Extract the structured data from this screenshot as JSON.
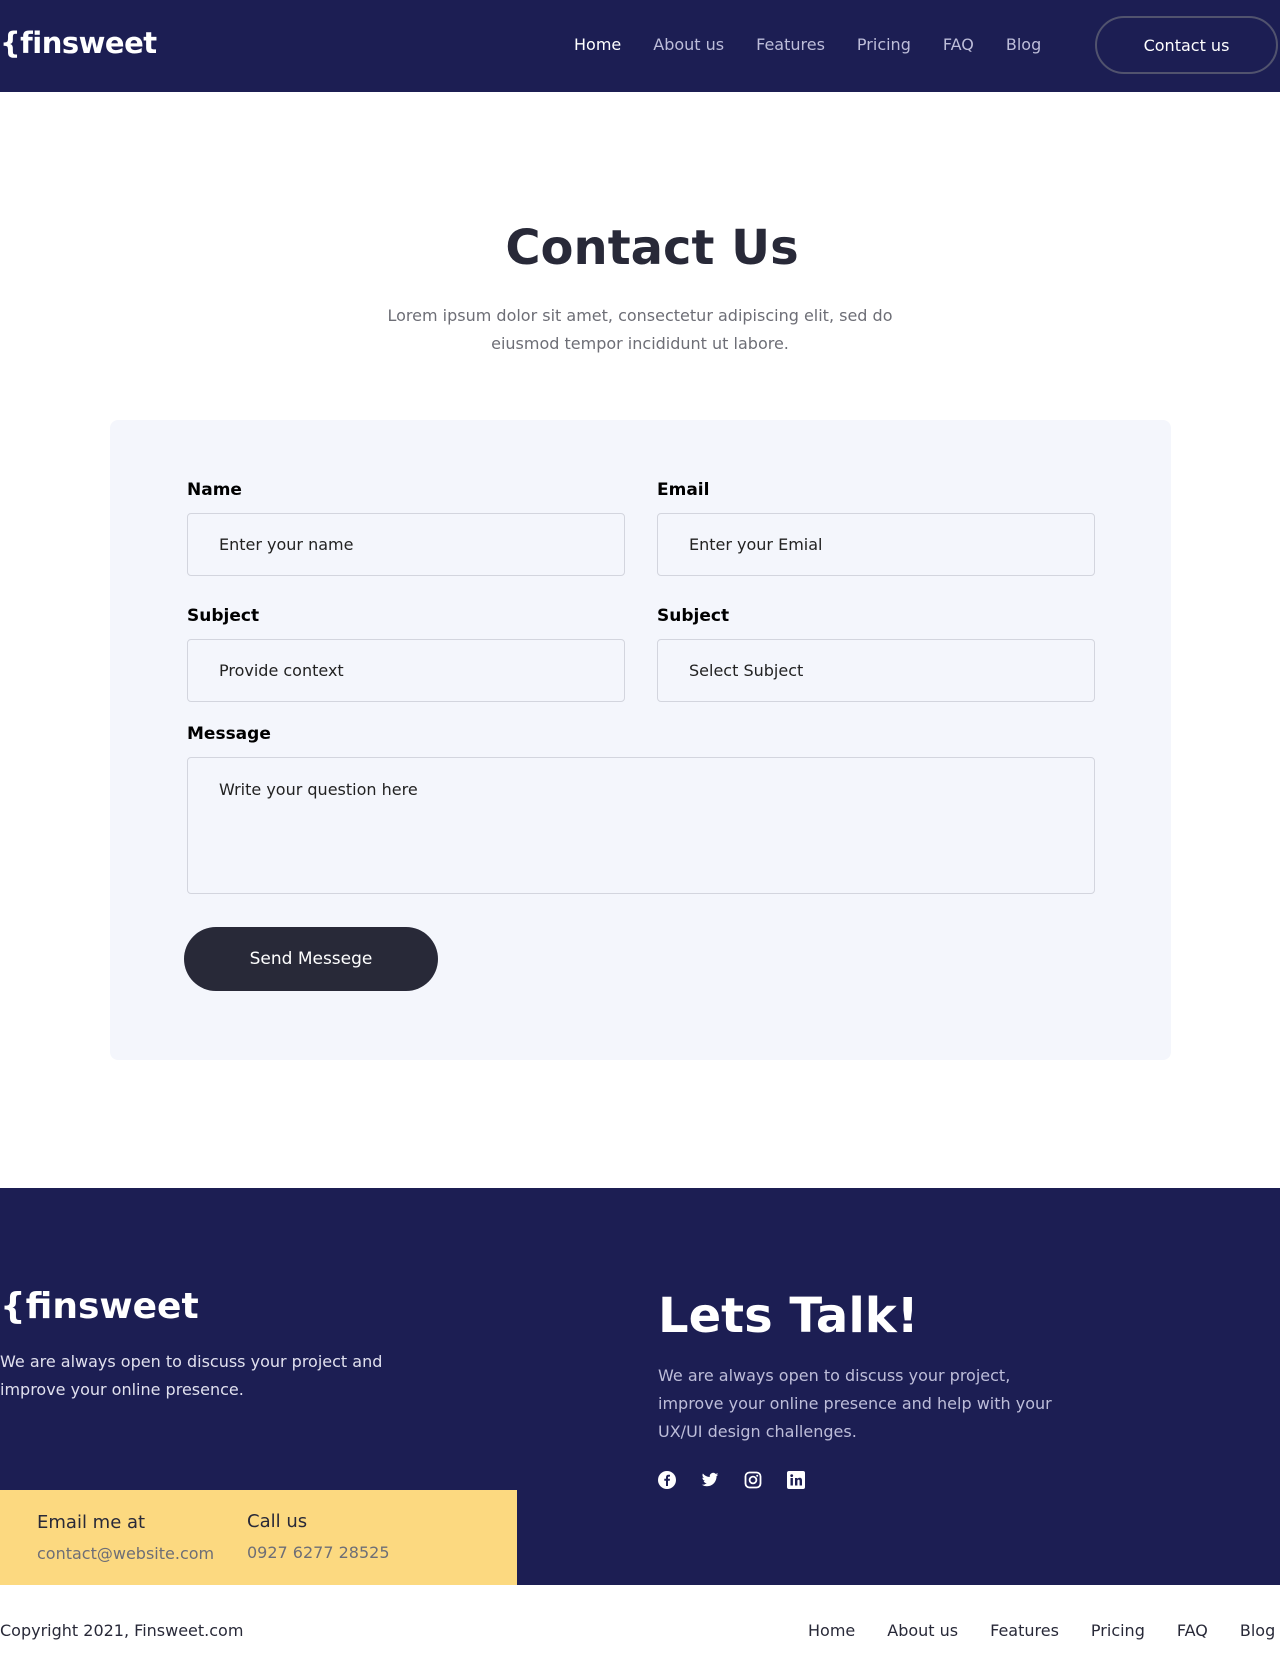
{
  "header": {
    "logo": "{finsweet",
    "nav": [
      "Home",
      "About us",
      "Features",
      "Pricing",
      "FAQ",
      "Blog"
    ],
    "active_nav": "Home",
    "contact_button": "Contact us"
  },
  "hero": {
    "title": "Contact Us",
    "subtitle": "Lorem ipsum dolor sit amet, consectetur adipiscing elit, sed do eiusmod tempor incididunt ut labore."
  },
  "form": {
    "name_label": "Name",
    "name_placeholder": "Enter your name",
    "email_label": "Email",
    "email_placeholder": "Enter your Emial",
    "subject_label": "Subject",
    "subject_placeholder": "Provide context",
    "subject2_label": "Subject",
    "subject2_placeholder": "Select Subject",
    "message_label": "Message",
    "message_placeholder": "Write your  question here",
    "send_button": "Send Messege"
  },
  "footer": {
    "logo": "{finsweet",
    "description": "We are always open to discuss your project and improve your online presence.",
    "email_title": "Email me at",
    "email_value": "contact@website.com",
    "call_title": "Call us",
    "call_value": "0927 6277 28525",
    "talk_title": "Lets Talk!",
    "talk_desc": "We are always open to discuss your project, improve your online presence and help with your UX/UI design challenges.",
    "socials": [
      "facebook-icon",
      "twitter-icon",
      "instagram-icon",
      "linkedin-icon"
    ]
  },
  "bottom": {
    "copyright": "Copyright 2021, Finsweet.com",
    "nav": [
      "Home",
      "About us",
      "Features",
      "Pricing",
      "FAQ",
      "Blog"
    ]
  },
  "colors": {
    "primary_dark": "#1c1e53",
    "accent_yellow": "#fcd980",
    "button_dark": "#282938",
    "card_bg": "#f4f6fc"
  }
}
